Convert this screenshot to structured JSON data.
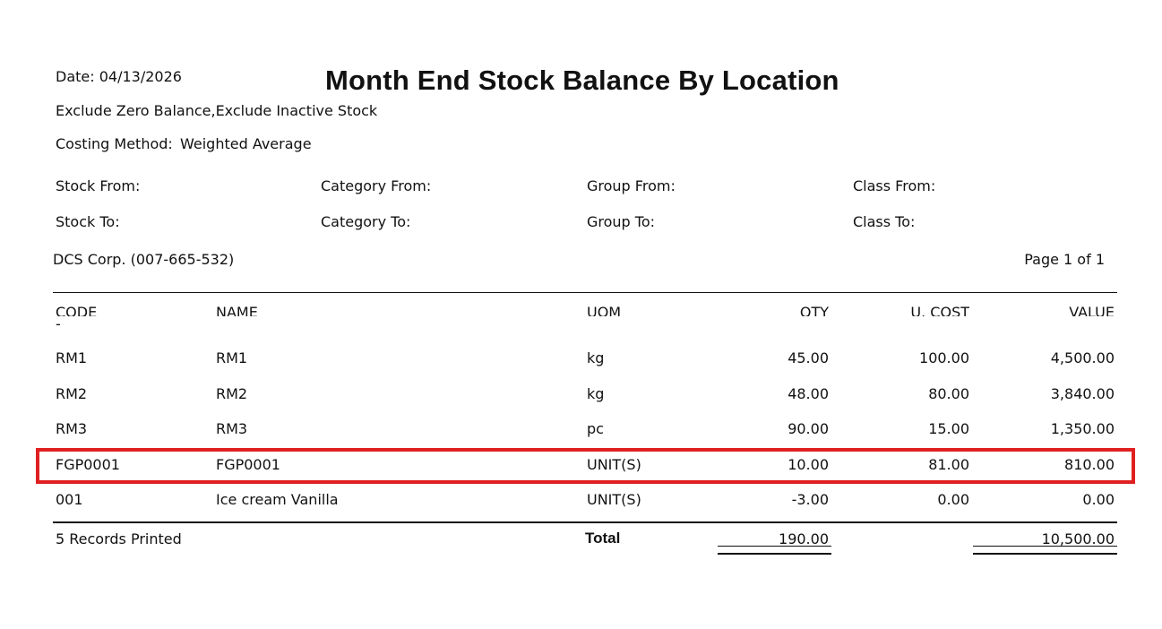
{
  "report": {
    "title": "Month End Stock Balance By Location",
    "date_label": "Date: 04/13/2026",
    "filter_text": "Exclude Zero Balance,Exclude Inactive Stock",
    "costing_label": "Costing Method:",
    "costing_value": "Weighted Average",
    "company": "DCS Corp. (007-665-532)",
    "page": "Page 1 of 1"
  },
  "ranges": {
    "stock_from": "Stock From:",
    "stock_to": "Stock To:",
    "category_from": "Category From:",
    "category_to": "Category To:",
    "group_from": "Group From:",
    "group_to": "Group To:",
    "class_from": "Class From:",
    "class_to": "Class To:"
  },
  "table": {
    "headers": {
      "code": "CODE",
      "name": "NAME",
      "uom": "UOM",
      "qty": "QTY",
      "u_cost": "U. COST",
      "value": "VALUE"
    },
    "dash": "-",
    "rows": [
      {
        "code": "RM1",
        "name": "RM1",
        "uom": "kg",
        "qty": "45.00",
        "u_cost": "100.00",
        "value": "4,500.00"
      },
      {
        "code": "RM2",
        "name": "RM2",
        "uom": "kg",
        "qty": "48.00",
        "u_cost": "80.00",
        "value": "3,840.00"
      },
      {
        "code": "RM3",
        "name": "RM3",
        "uom": "pc",
        "qty": "90.00",
        "u_cost": "15.00",
        "value": "1,350.00"
      },
      {
        "code": "FGP0001",
        "name": "FGP0001",
        "uom": "UNIT(S)",
        "qty": "10.00",
        "u_cost": "81.00",
        "value": "810.00"
      },
      {
        "code": "001",
        "name": "Ice cream Vanilla",
        "uom": "UNIT(S)",
        "qty": "-3.00",
        "u_cost": "0.00",
        "value": "0.00"
      }
    ],
    "footer": {
      "records": "5 Records Printed",
      "total_label": "Total",
      "total_qty": "190.00",
      "total_value": "10,500.00"
    }
  },
  "colors": {
    "highlight": "#e02020"
  }
}
